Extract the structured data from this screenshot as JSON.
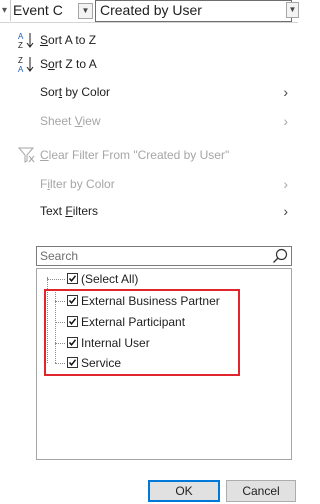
{
  "header": {
    "prev_column": "Event C",
    "current_column": "Created by User"
  },
  "menu": {
    "sort_az": "Sort A to Z",
    "sort_za": "Sort Z to A",
    "sort_by_color": "Sort by Color",
    "sheet_view": "Sheet View",
    "clear_filter": "Clear Filter From \"Created by User\"",
    "filter_by_color": "Filter by Color",
    "text_filters": "Text Filters"
  },
  "search": {
    "placeholder": "Search"
  },
  "values": {
    "select_all": "(Select All)",
    "items": [
      "External Business Partner",
      "External Participant",
      "Internal User",
      "Service"
    ]
  },
  "buttons": {
    "ok": "OK",
    "cancel": "Cancel"
  },
  "colors": {
    "highlight": "#e0262c",
    "ok_border": "#0078d7"
  }
}
